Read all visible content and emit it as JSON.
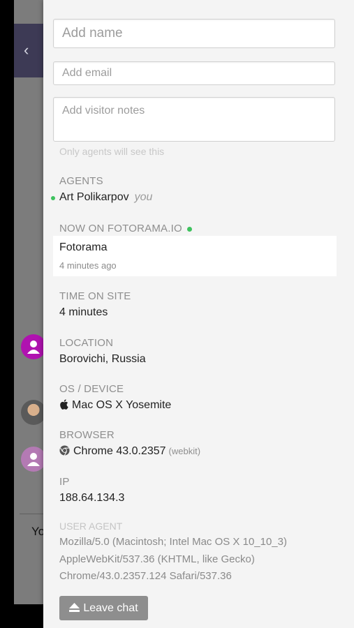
{
  "background": {
    "you_text": "Yo"
  },
  "form": {
    "name_placeholder": "Add name",
    "email_placeholder": "Add email",
    "notes_placeholder": "Add visitor notes",
    "notes_hint": "Only agents will see this"
  },
  "agents": {
    "label": "AGENTS",
    "name": "Art Polikarpov",
    "you_tag": "you"
  },
  "now_on": {
    "label": "NOW ON FOTORAMA.IO",
    "page_title": "Fotorama",
    "time_ago": "4 minutes ago"
  },
  "time_on_site": {
    "label": "TIME ON SITE",
    "value": "4 minutes"
  },
  "location": {
    "label": "LOCATION",
    "value": "Borovichi, Russia"
  },
  "os": {
    "label": "OS / DEVICE",
    "value": "Mac OS X Yosemite",
    "icon": "apple-icon"
  },
  "browser": {
    "label": "BROWSER",
    "value": "Chrome 43.0.2357",
    "engine": "(webkit)",
    "icon": "chrome-icon"
  },
  "ip": {
    "label": "IP",
    "value": "188.64.134.3"
  },
  "user_agent": {
    "label": "USER AGENT",
    "lines": [
      "Mozilla/5.0 (Macintosh; Intel Mac OS X 10_10_3)",
      "AppleWebKit/537.36 (KHTML, like Gecko)",
      "Chrome/43.0.2357.124 Safari/537.36"
    ]
  },
  "actions": {
    "leave_chat": "Leave chat"
  },
  "colors": {
    "online": "#3ec25e",
    "visitor_avatar": "#b012b0",
    "topbar": "#3d3a55"
  }
}
